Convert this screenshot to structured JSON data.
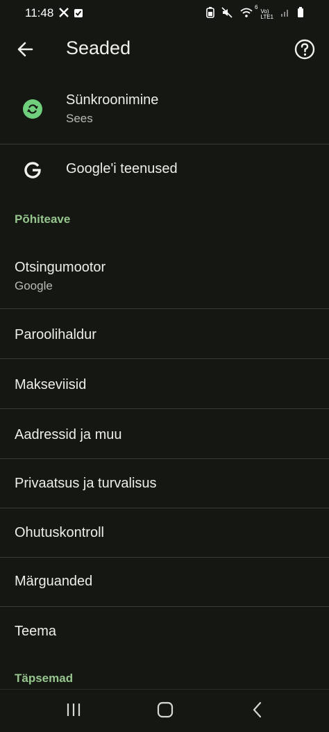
{
  "status_bar": {
    "time": "11:48",
    "icons": [
      "x-icon",
      "check-square-icon",
      "battery-saver-icon",
      "mute-icon",
      "wifi-icon",
      "volte-icon",
      "signal-icon",
      "battery-icon"
    ],
    "volte_label": "Vo)",
    "lte_label": "LTE1",
    "wifi_label": "6"
  },
  "header": {
    "title": "Seaded"
  },
  "account": {
    "sync": {
      "title": "Sünkroonimine",
      "subtitle": "Sees"
    },
    "google_services": {
      "title": "Google'i teenused"
    }
  },
  "sections": {
    "basics": {
      "label": "Põhiteave",
      "search_engine": {
        "title": "Otsingumootor",
        "subtitle": "Google"
      },
      "items": [
        "Paroolihaldur",
        "Makseviisid",
        "Aadressid ja muu",
        "Privaatsus ja turvalisus",
        "Ohutuskontroll",
        "Märguanded",
        "Teema"
      ]
    },
    "advanced": {
      "label": "Täpsemad"
    }
  },
  "nav_bar": {
    "buttons": [
      "recent-apps-icon",
      "home-icon",
      "back-nav-icon"
    ]
  },
  "colors": {
    "background": "#151812",
    "accent": "#96c58e",
    "sync_badge": "#6fcf7d"
  }
}
